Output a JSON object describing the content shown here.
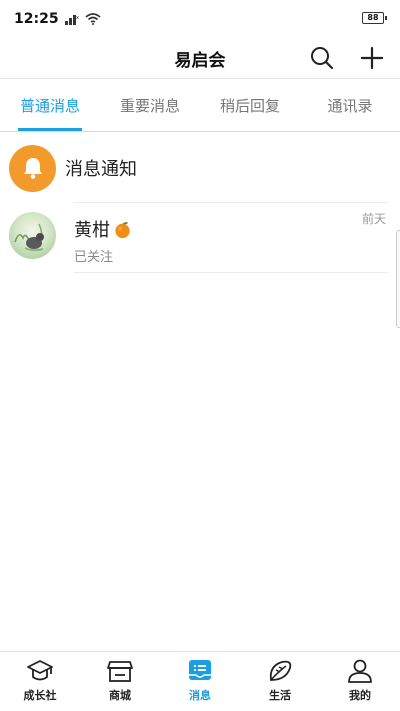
{
  "status_bar": {
    "time": "12:25",
    "battery": "88"
  },
  "header": {
    "title": "易启会",
    "search_icon": "search-icon",
    "add_icon": "plus-icon"
  },
  "tabs": [
    {
      "label": "普通消息",
      "active": true
    },
    {
      "label": "重要消息",
      "active": false
    },
    {
      "label": "稍后回复",
      "active": false
    },
    {
      "label": "通讯录",
      "active": false
    }
  ],
  "notice": {
    "label": "消息通知",
    "icon": "bell-icon"
  },
  "chats": [
    {
      "name": "黄柑",
      "emoji": "orange-icon",
      "status": "已关注",
      "time": "前天"
    }
  ],
  "bottom_nav": [
    {
      "label": "成长社",
      "icon": "graduation-cap-icon",
      "active": false
    },
    {
      "label": "商城",
      "icon": "store-icon",
      "active": false
    },
    {
      "label": "消息",
      "icon": "message-icon",
      "active": true
    },
    {
      "label": "生活",
      "icon": "leaf-icon",
      "active": false
    },
    {
      "label": "我的",
      "icon": "user-icon",
      "active": false
    }
  ],
  "colors": {
    "accent": "#1a9fe0",
    "notice_bg": "#f29b2c"
  }
}
